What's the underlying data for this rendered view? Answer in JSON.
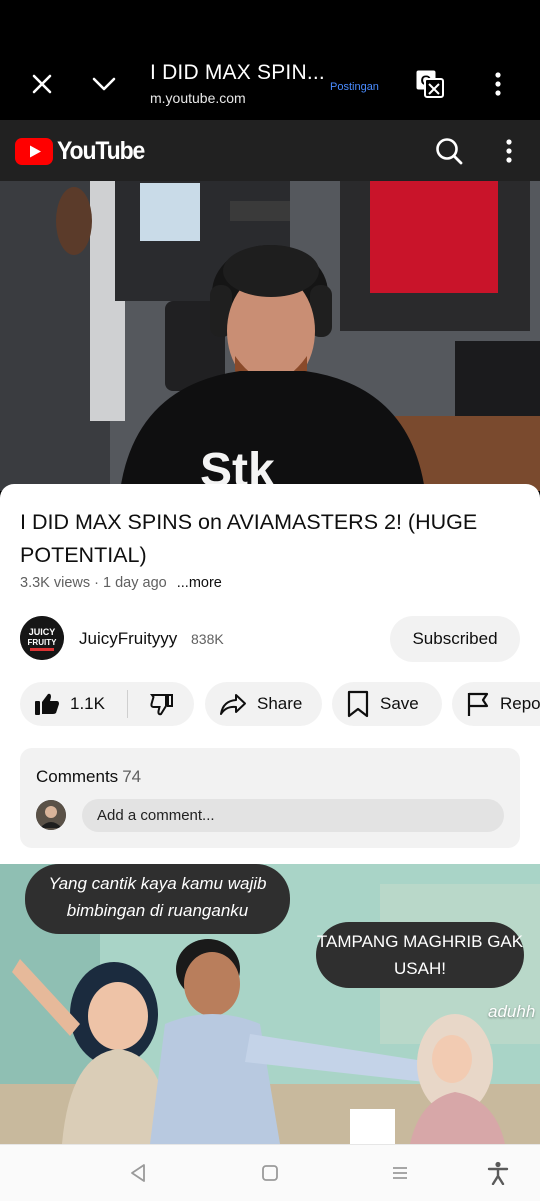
{
  "tab_bar": {
    "title": "I DID MAX SPIN...",
    "url": "m.youtube.com",
    "badge": "Postingan",
    "icons": [
      "close-icon",
      "chevron-down-icon",
      "translate-icon",
      "more-vert-icon"
    ]
  },
  "yt_header": {
    "logo_text": "YouTube",
    "brand_color": "#ff0000",
    "icons": [
      "search-icon",
      "more-vert-icon"
    ]
  },
  "video": {
    "title": "I DID MAX SPINS on AVIAMASTERS 2! (HUGE POTENTIAL)",
    "views": "3.3K views · 1 day ago",
    "more": "...more"
  },
  "channel": {
    "name": "JuicyFruityyy",
    "subscribers": "838K",
    "subscribe_button": "Subscribed",
    "avatar_text": "JUICY FRUITY"
  },
  "actions": {
    "like_count": "1.1K",
    "share": "Share",
    "save": "Save",
    "report": "Report"
  },
  "comments": {
    "label": "Comments",
    "count": "74",
    "placeholder": "Add a comment..."
  },
  "ad": {
    "bubble_1": "Yang cantik kaya kamu wajib bimbingan di ruanganku",
    "bubble_2": "TAMPANG MAGHRIB GAK USAH!",
    "exclaim": "aduhh"
  },
  "nav": {
    "icons": [
      "back-icon",
      "home-icon",
      "recents-icon",
      "accessibility-icon"
    ]
  }
}
